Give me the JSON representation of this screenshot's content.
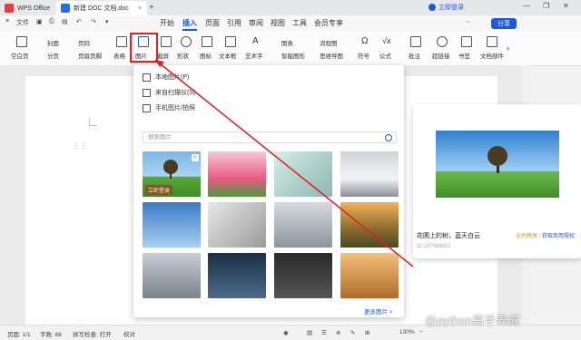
{
  "titlebar": {
    "app_tab": "WPS Office",
    "doc_tab": "新建 DOC 文档.doc",
    "new_tab": "+",
    "login": "立即登录",
    "win_controls": [
      "—",
      "❐",
      "✕"
    ]
  },
  "quickaccess": {
    "file": "文件",
    "icons": [
      "menu-icon",
      "save-icon",
      "print-icon",
      "undo-icon",
      "redo-icon"
    ]
  },
  "menu": {
    "items": [
      "开始",
      "插入",
      "页面",
      "引用",
      "审阅",
      "视图",
      "工具",
      "会员专享"
    ],
    "active": "插入",
    "share": "分享"
  },
  "ribbon": {
    "items": [
      "空白页",
      "封面",
      "分页",
      "页码",
      "页眉页脚",
      "表格",
      "图片",
      "截屏",
      "形状",
      "图标",
      "文本框",
      "艺术字",
      "图表",
      "智能图形",
      "流程图",
      "思维导图",
      "符号",
      "公式",
      "批注",
      "超链接",
      "书签",
      "文档部件"
    ]
  },
  "dropdown": {
    "items": [
      "本地图片(P)",
      "来自扫描仪(S)",
      "手机图片/拍照"
    ],
    "search_placeholder": "搜索图片",
    "badge": "立即登录",
    "more": "更多图片 >"
  },
  "preview": {
    "title": "花圃上的树，蓝天白云",
    "id": "ID:197689821",
    "license_a": "全民畅享",
    "sep": " / ",
    "license_b": "获取商用授权"
  },
  "status": {
    "page": "页面: 1/1",
    "words": "字数: 68",
    "spell": "拼写检查: 打开",
    "proof": "校对",
    "zoom": "130%"
  },
  "watermark": "@python高手养成",
  "colors": {
    "accent": "#1e5ad7",
    "highlight": "#e02020"
  }
}
